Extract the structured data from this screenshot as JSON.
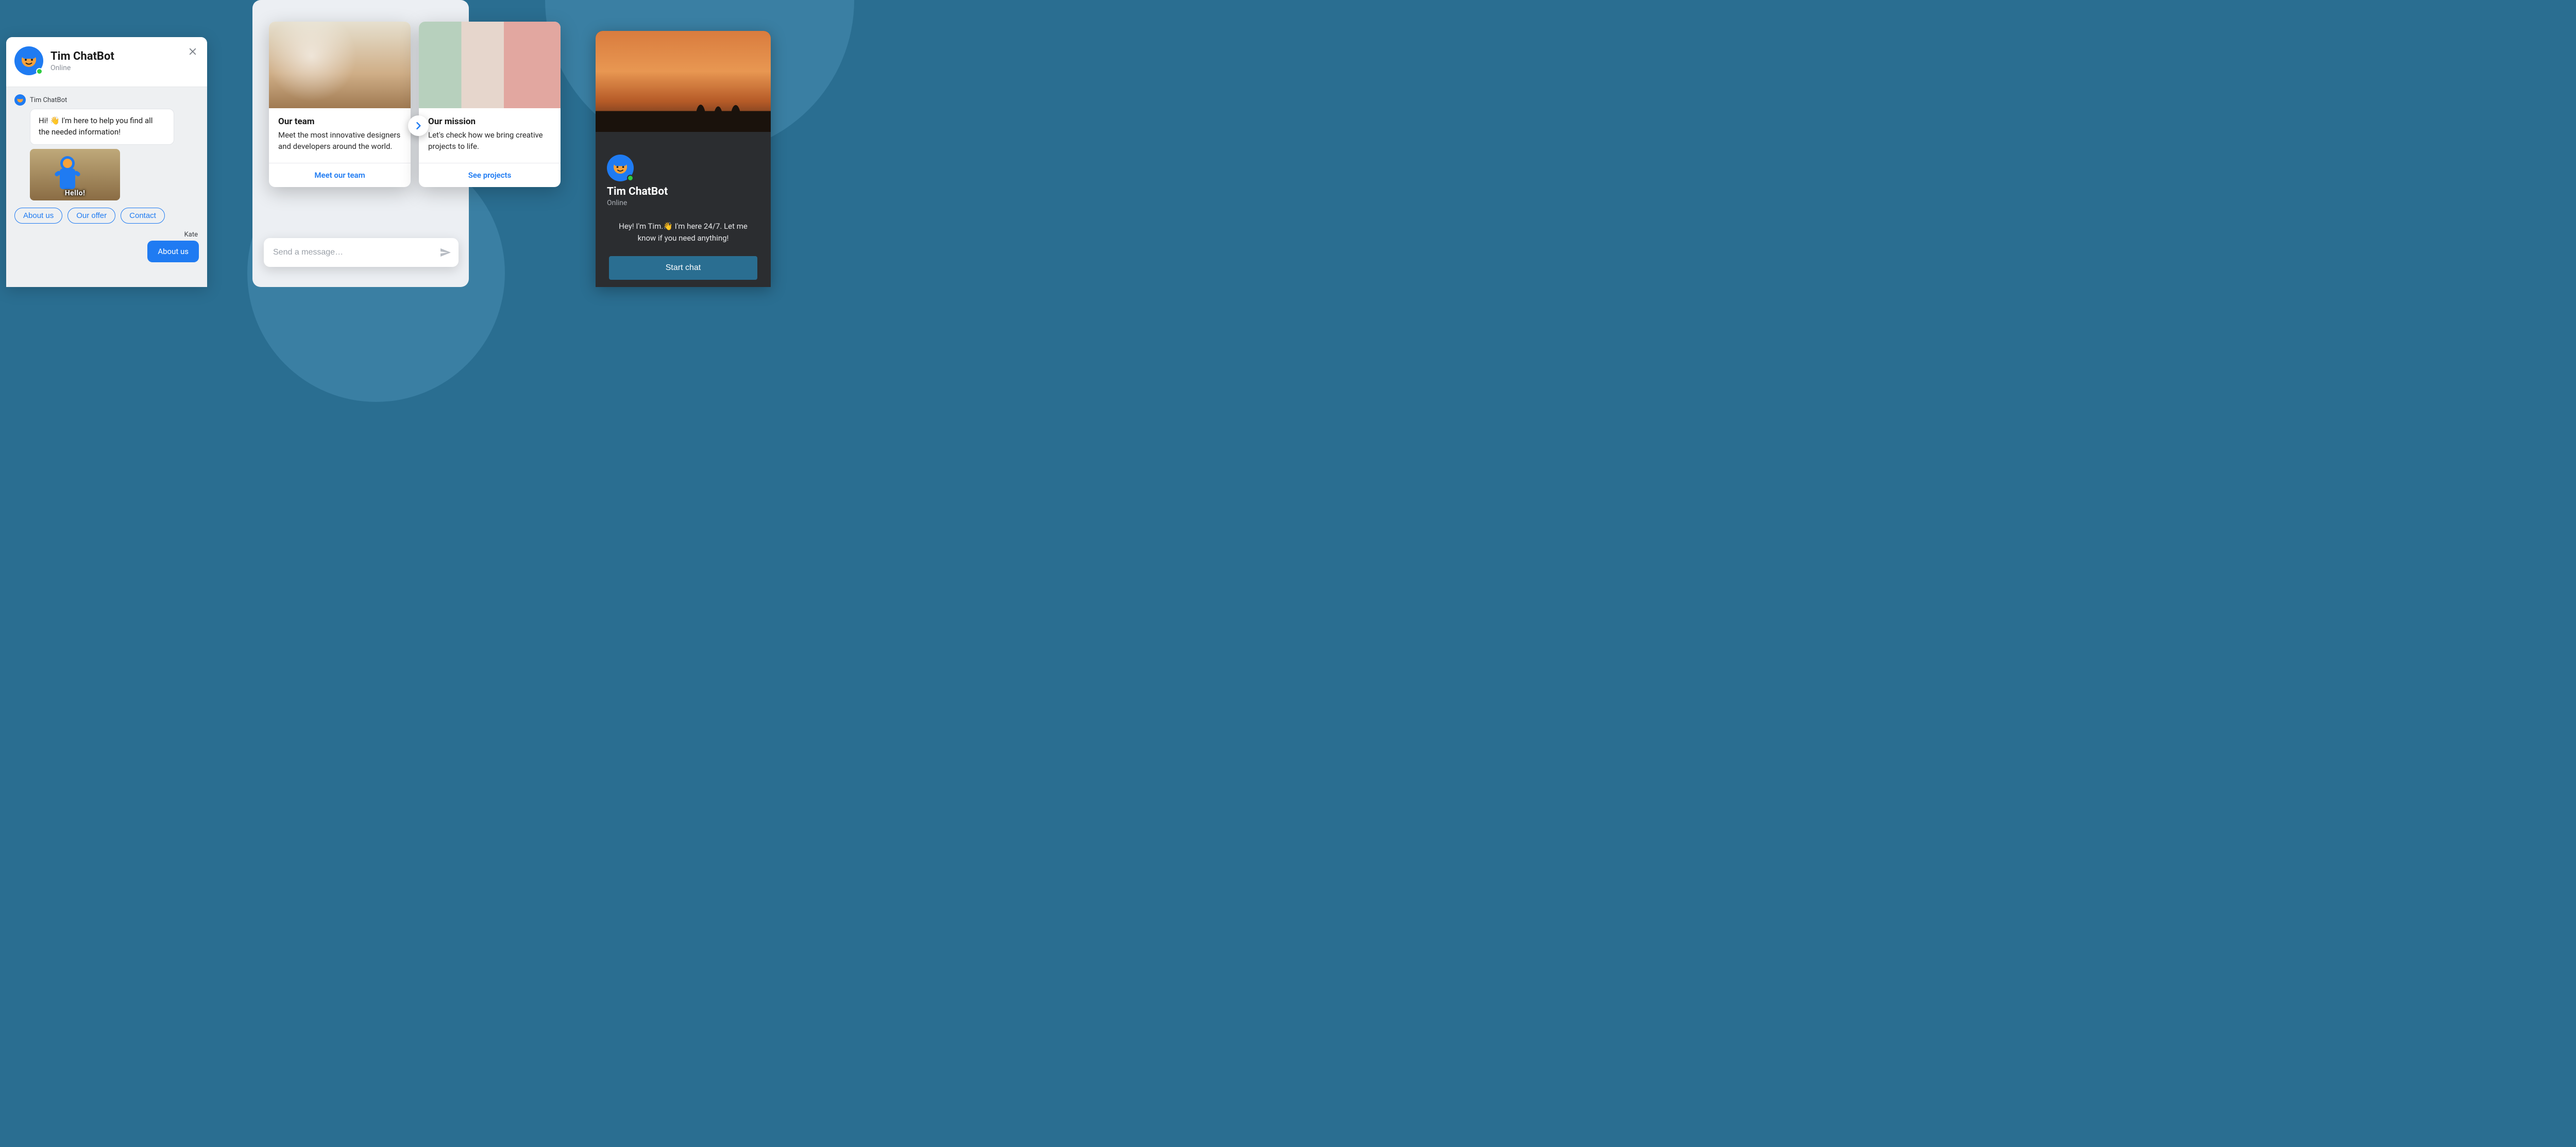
{
  "colors": {
    "accent": "#1f7bf2",
    "bg": "#2a6e91",
    "dark_panel": "#2b2d30",
    "online": "#2ecc40"
  },
  "chat": {
    "title": "Tim ChatBot",
    "status": "Online",
    "bot_name": "Tim ChatBot",
    "greeting_prefix": "Hi! ",
    "greeting_emoji": "👋",
    "greeting_suffix": " I'm here to help you find all the needed information!",
    "rich_caption": "Hello!",
    "quick_replies": [
      "About us",
      "Our offer",
      "Contact"
    ],
    "user_name": "Kate",
    "user_reply": "About us"
  },
  "carousel": {
    "cards": [
      {
        "title": "Our team",
        "text": "Meet the most innovative designers and developers around the world.",
        "cta": "Meet our team"
      },
      {
        "title": "Our mission",
        "text": "Let's check how we bring creative projects to life.",
        "cta": "See projects"
      }
    ]
  },
  "composer": {
    "placeholder": "Send a message…"
  },
  "launcher": {
    "title": "Tim ChatBot",
    "status": "Online",
    "greeting_prefix": "Hey! I'm Tim.",
    "greeting_emoji": "👋",
    "greeting_suffix": " I'm here 24/7. Let me know if you need anything!",
    "button": "Start chat"
  }
}
